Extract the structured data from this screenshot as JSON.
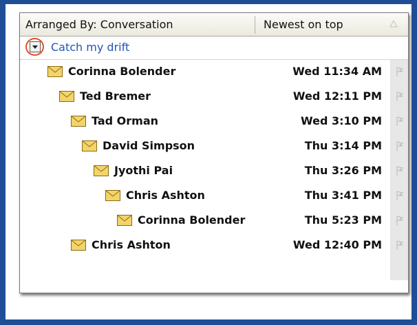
{
  "header": {
    "arrange_label": "Arranged By: Conversation",
    "sort_label": "Newest on top",
    "sort_icon": "sort-triangle-icon"
  },
  "conversation": {
    "subject": "Catch my drift",
    "expand_icon": "expand-arrow-icon"
  },
  "messages": [
    {
      "sender": "Corinna Bolender",
      "time": "Wed 11:34 AM"
    },
    {
      "sender": "Ted Bremer",
      "time": "Wed 12:11 PM"
    },
    {
      "sender": "Tad Orman",
      "time": "Wed 3:10 PM"
    },
    {
      "sender": "David Simpson",
      "time": "Thu 3:14 PM"
    },
    {
      "sender": "Jyothi Pai",
      "time": "Thu 3:26 PM"
    },
    {
      "sender": "Chris Ashton",
      "time": "Thu 3:41 PM"
    },
    {
      "sender": "Corinna Bolender",
      "time": "Thu 5:23 PM"
    },
    {
      "sender": "Chris Ashton",
      "time": "Wed 12:40 PM"
    }
  ],
  "colors": {
    "background": "#1f4e96",
    "subject": "#1f56b7",
    "highlight": "#e0502a",
    "envelope": "#e8c24a"
  }
}
